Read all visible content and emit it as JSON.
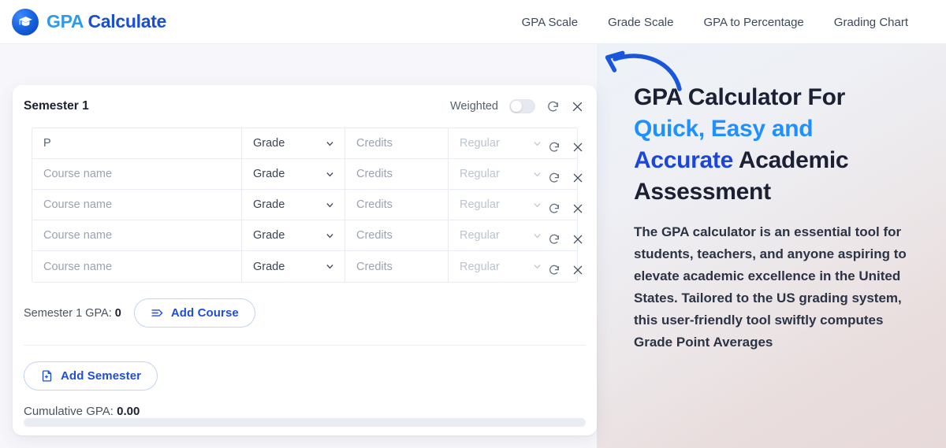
{
  "header": {
    "brand_part1": "GPA ",
    "brand_part2": "Calculate",
    "logo_icon": "graduation-cap-icon",
    "nav": [
      {
        "label": "GPA Scale"
      },
      {
        "label": "Grade Scale"
      },
      {
        "label": "GPA to Percentage"
      },
      {
        "label": "Grading Chart"
      }
    ]
  },
  "hero": {
    "arrow_icon": "curved-arrow-left-icon",
    "title_line1": "GPA Calculator For",
    "title_line2": "Quick, Easy and",
    "title_line3a": "Accurate",
    "title_line3b": " Academic",
    "title_line4": "Assessment",
    "body": "The GPA calculator is an essential tool for students, teachers, and anyone aspiring to elevate academic excellence in the United States. Tailored to the US grading system, this user-friendly tool swiftly computes Grade Point Averages",
    "accent_light": "#1e90ff",
    "accent_dark": "#1a47d8"
  },
  "calculator": {
    "semester_title": "Semester 1",
    "weighted_label": "Weighted",
    "weighted_on": false,
    "reset_icon": "refresh-icon",
    "close_icon": "close-icon",
    "columns": {
      "course": "Course name",
      "grade": "Grade",
      "credits": "Credits",
      "type": "Regular"
    },
    "rows": [
      {
        "course_value": "P",
        "course_is_value": true,
        "grade": "Grade",
        "credits": "Credits",
        "type": "Regular"
      },
      {
        "course_value": "Course name",
        "course_is_value": false,
        "grade": "Grade",
        "credits": "Credits",
        "type": "Regular"
      },
      {
        "course_value": "Course name",
        "course_is_value": false,
        "grade": "Grade",
        "credits": "Credits",
        "type": "Regular"
      },
      {
        "course_value": "Course name",
        "course_is_value": false,
        "grade": "Grade",
        "credits": "Credits",
        "type": "Regular"
      },
      {
        "course_value": "Course name",
        "course_is_value": false,
        "grade": "Grade",
        "credits": "Credits",
        "type": "Regular"
      }
    ],
    "semester_gpa_label": "Semester 1 GPA:",
    "semester_gpa_value": "0",
    "add_course_label": "Add Course",
    "add_course_icon": "add-rows-icon",
    "add_semester_label": "Add Semester",
    "add_semester_icon": "file-plus-icon",
    "cumulative_label": "Cumulative GPA:",
    "cumulative_value": "0.00"
  }
}
